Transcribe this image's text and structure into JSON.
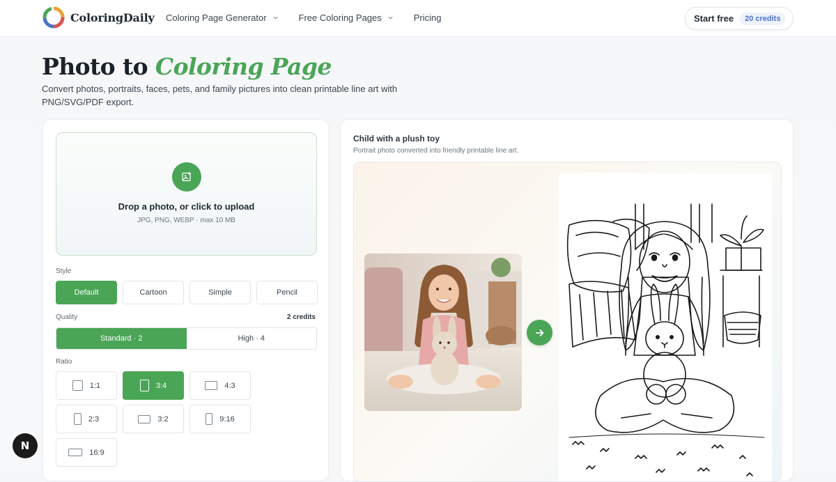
{
  "brand": {
    "name": "ColoringDaily"
  },
  "nav": {
    "links": [
      {
        "label": "Coloring Page Generator",
        "dropdown": true
      },
      {
        "label": "Free Coloring Pages",
        "dropdown": true
      },
      {
        "label": "Pricing",
        "dropdown": false
      }
    ],
    "start_label": "Start free",
    "credits_label": "20 credits"
  },
  "hero": {
    "title_plain": "Photo to ",
    "title_accent": "Coloring Page",
    "subtitle": "Convert photos, portraits, faces, pets, and family pictures into clean printable line art with PNG/SVG/PDF export."
  },
  "upload": {
    "title": "Drop a photo, or click to upload",
    "hint": "JPG, PNG, WEBP · max 10 MB"
  },
  "style": {
    "label": "Style",
    "options": [
      "Default",
      "Cartoon",
      "Simple",
      "Pencil"
    ],
    "selected": "Default"
  },
  "quality": {
    "label": "Quality",
    "cost": "2 credits",
    "options": [
      "Standard · 2",
      "High · 4"
    ],
    "selected": "Standard · 2"
  },
  "ratio": {
    "label": "Ratio",
    "options": [
      "1:1",
      "3:4",
      "4:3",
      "2:3",
      "3:2",
      "9:16",
      "16:9"
    ],
    "selected": "3:4"
  },
  "example": {
    "title": "Child with a plush toy",
    "subtitle": "Portrait photo converted into friendly printable line art."
  },
  "badge": {
    "label": "N"
  },
  "colors": {
    "accent": "#4aa556",
    "credits_text": "#4a73c9",
    "badge_bg": "#1b1b1b"
  }
}
